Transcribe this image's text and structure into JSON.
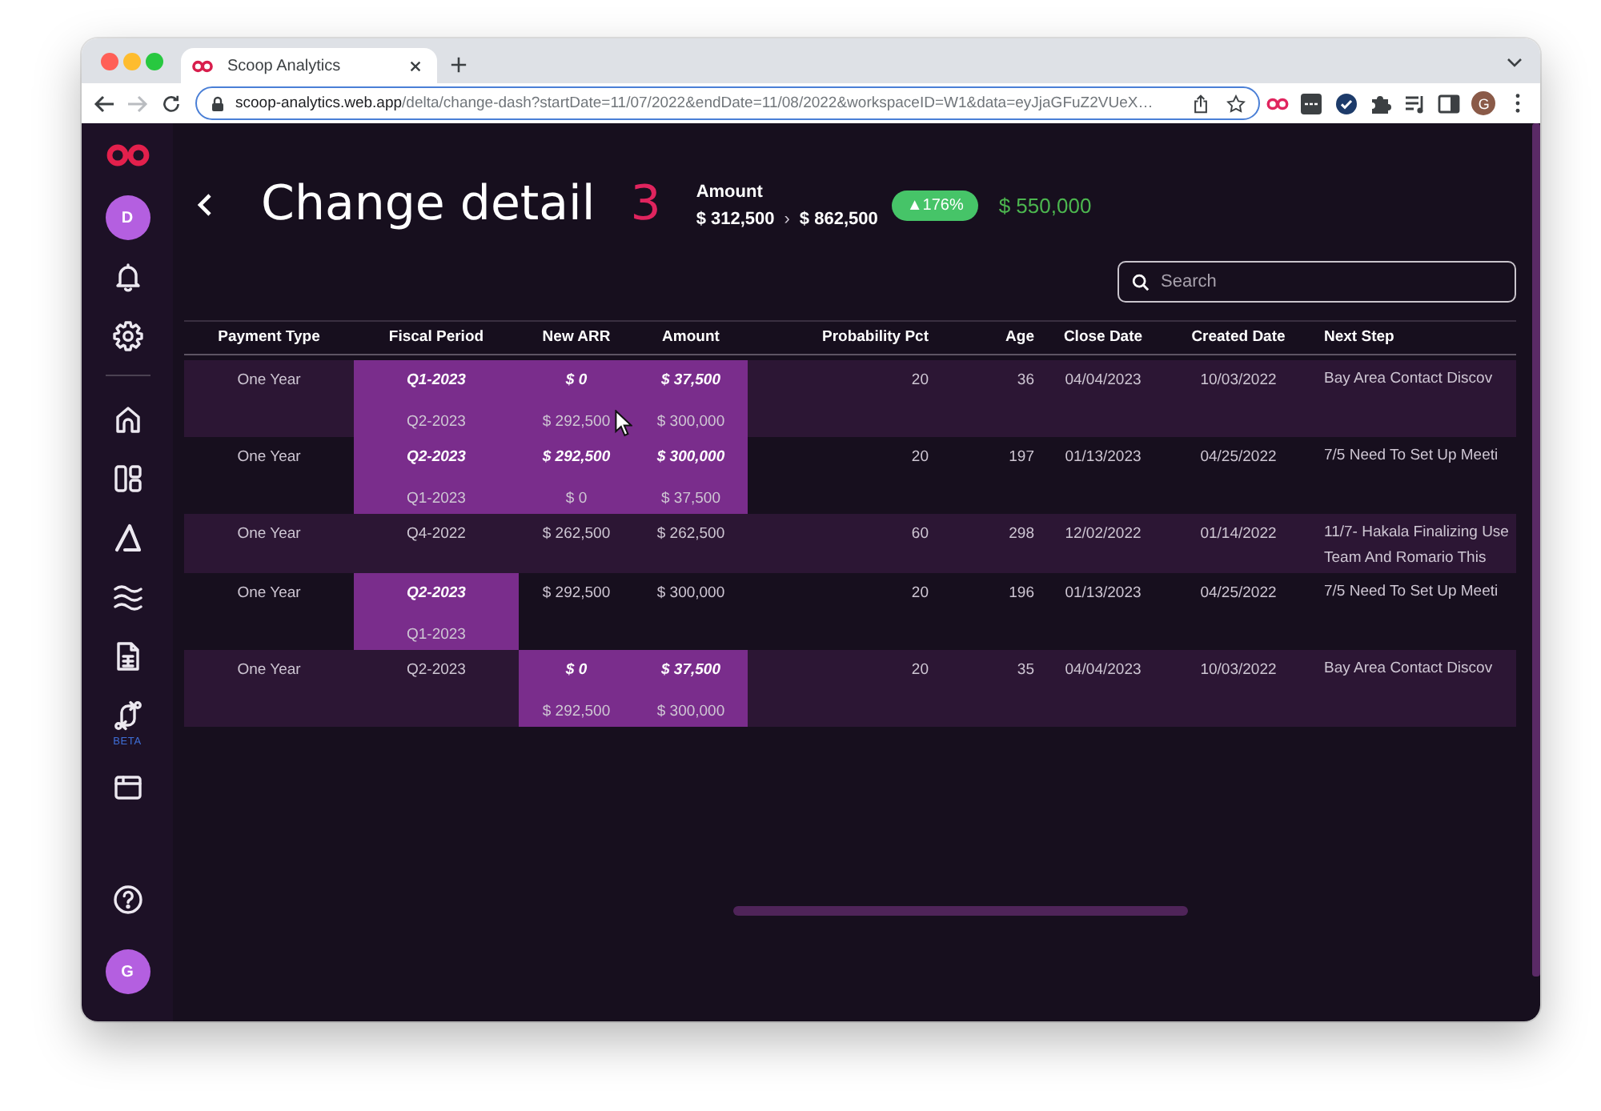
{
  "browser": {
    "tabs": [
      {
        "title": "Scoop Analytics",
        "selected": true
      }
    ],
    "address": {
      "host": "scoop-analytics.web.app",
      "path": "/delta/change-dash?startDate=11/07/2022&endDate=11/08/2022&workspaceID=W1&data=eyJjaGFuZ2VUeX…"
    },
    "profile_initial": "G"
  },
  "sidebar": {
    "user_initial": "D",
    "beta_label": "BETA",
    "account_initial": "G"
  },
  "header": {
    "title": "Change detail",
    "count": "3",
    "metric": {
      "label": "Amount",
      "from": "$ 312,500",
      "separator": "›",
      "to": "$ 862,500"
    },
    "change_badge": "▲176%",
    "difference": "$ 550,000"
  },
  "search": {
    "placeholder": "Search"
  },
  "table": {
    "columns": [
      "Payment Type",
      "Fiscal Period",
      "New ARR",
      "Amount",
      "Probability Pct",
      "Age",
      "Close Date",
      "Created Date",
      "Next Step"
    ],
    "rows": [
      {
        "cells": [
          {
            "values": [
              "One Year"
            ],
            "changed": false
          },
          {
            "values": [
              "Q1-2023",
              "Q2-2023"
            ],
            "changed": true
          },
          {
            "values": [
              "$ 0",
              "$ 292,500"
            ],
            "changed": true
          },
          {
            "values": [
              "$ 37,500",
              "$ 300,000"
            ],
            "changed": true
          },
          {
            "values": [
              "20"
            ],
            "changed": false
          },
          {
            "values": [
              "36"
            ],
            "changed": false
          },
          {
            "values": [
              "04/04/2023"
            ],
            "changed": false
          },
          {
            "values": [
              "10/03/2022"
            ],
            "changed": false
          },
          {
            "values": [
              "Bay Area Contact Discov"
            ],
            "changed": false
          }
        ]
      },
      {
        "cells": [
          {
            "values": [
              "One Year"
            ],
            "changed": false
          },
          {
            "values": [
              "Q2-2023",
              "Q1-2023"
            ],
            "changed": true
          },
          {
            "values": [
              "$ 292,500",
              "$ 0"
            ],
            "changed": true
          },
          {
            "values": [
              "$ 300,000",
              "$ 37,500"
            ],
            "changed": true
          },
          {
            "values": [
              "20"
            ],
            "changed": false
          },
          {
            "values": [
              "197"
            ],
            "changed": false
          },
          {
            "values": [
              "01/13/2023"
            ],
            "changed": false
          },
          {
            "values": [
              "04/25/2022"
            ],
            "changed": false
          },
          {
            "values": [
              "7/5 Need To Set Up Meeti"
            ],
            "changed": false
          }
        ]
      },
      {
        "cells": [
          {
            "values": [
              "One Year"
            ],
            "changed": false
          },
          {
            "values": [
              "Q4-2022"
            ],
            "changed": false
          },
          {
            "values": [
              "$ 262,500"
            ],
            "changed": false
          },
          {
            "values": [
              "$ 262,500"
            ],
            "changed": false
          },
          {
            "values": [
              "60"
            ],
            "changed": false
          },
          {
            "values": [
              "298"
            ],
            "changed": false
          },
          {
            "values": [
              "12/02/2022"
            ],
            "changed": false
          },
          {
            "values": [
              "01/14/2022"
            ],
            "changed": false
          },
          {
            "values": [
              "11/7- Hakala Finalizing Use Team And Romario This"
            ],
            "changed": false
          }
        ]
      },
      {
        "cells": [
          {
            "values": [
              "One Year"
            ],
            "changed": false
          },
          {
            "values": [
              "Q2-2023",
              "Q1-2023"
            ],
            "changed": true
          },
          {
            "values": [
              "$ 292,500"
            ],
            "changed": false
          },
          {
            "values": [
              "$ 300,000"
            ],
            "changed": false
          },
          {
            "values": [
              "20"
            ],
            "changed": false
          },
          {
            "values": [
              "196"
            ],
            "changed": false
          },
          {
            "values": [
              "01/13/2023"
            ],
            "changed": false
          },
          {
            "values": [
              "04/25/2022"
            ],
            "changed": false
          },
          {
            "values": [
              "7/5 Need To Set Up Meeti"
            ],
            "changed": false
          }
        ]
      },
      {
        "cells": [
          {
            "values": [
              "One Year"
            ],
            "changed": false
          },
          {
            "values": [
              "Q2-2023"
            ],
            "changed": false
          },
          {
            "values": [
              "$ 0",
              "$ 292,500"
            ],
            "changed": true
          },
          {
            "values": [
              "$ 37,500",
              "$ 300,000"
            ],
            "changed": true
          },
          {
            "values": [
              "20"
            ],
            "changed": false
          },
          {
            "values": [
              "35"
            ],
            "changed": false
          },
          {
            "values": [
              "04/04/2023"
            ],
            "changed": false
          },
          {
            "values": [
              "10/03/2022"
            ],
            "changed": false
          },
          {
            "values": [
              "Bay Area Contact Discov"
            ],
            "changed": false
          }
        ]
      }
    ]
  }
}
